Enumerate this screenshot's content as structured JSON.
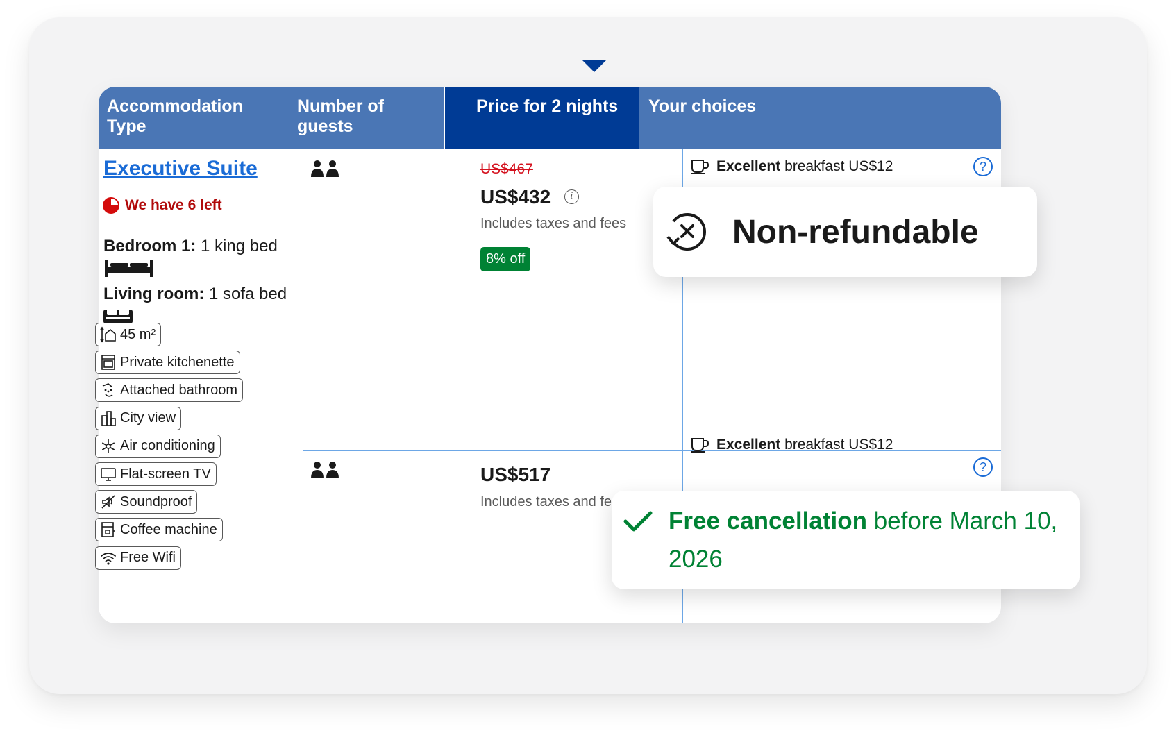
{
  "table": {
    "headers": {
      "accommodation": "Accommodation Type",
      "guests": "Number of guests",
      "price": "Price for 2 nights",
      "choices": "Your choices"
    }
  },
  "room": {
    "name": "Executive Suite",
    "scarcity": "We have 6 left",
    "bedroom_label": "Bedroom 1:",
    "bedroom_value": "1 king bed",
    "living_label": "Living room:",
    "living_value": "1 sofa bed",
    "facilities": [
      {
        "label": "45 m²",
        "icon": "room-size-icon"
      },
      {
        "label": "Private kitchenette",
        "icon": "kitchenette-icon"
      },
      {
        "label": "Attached bathroom",
        "icon": "bathroom-icon"
      },
      {
        "label": "City view",
        "icon": "city-icon"
      },
      {
        "label": "Air conditioning",
        "icon": "snowflake-icon"
      },
      {
        "label": "Flat-screen TV",
        "icon": "tv-icon"
      },
      {
        "label": "Soundproof",
        "icon": "soundproof-icon"
      },
      {
        "label": "Coffee machine",
        "icon": "coffee-machine-icon"
      },
      {
        "label": "Free Wifi",
        "icon": "wifi-icon"
      }
    ]
  },
  "options": [
    {
      "old_price": "US$467",
      "price": "US$432",
      "taxes": "Includes taxes and fees",
      "deal": "8% off",
      "breakfast_bold": "Excellent",
      "breakfast_text": "breakfast US$12"
    },
    {
      "price": "US$517",
      "taxes": "Includes taxes and fe",
      "breakfast_bold": "Excellent",
      "breakfast_text": "breakfast US$12"
    }
  ],
  "popups": {
    "non_refundable": "Non-refundable",
    "free_cancel_bold": "Free cancellation",
    "free_cancel_rest": "before March 10, 2026"
  },
  "colors": {
    "header": "#4a76b5",
    "header_active": "#003b95",
    "link": "#1a6bd6",
    "scarcity": "#b10a0a",
    "deal": "#008234",
    "strike": "#d4111e"
  }
}
